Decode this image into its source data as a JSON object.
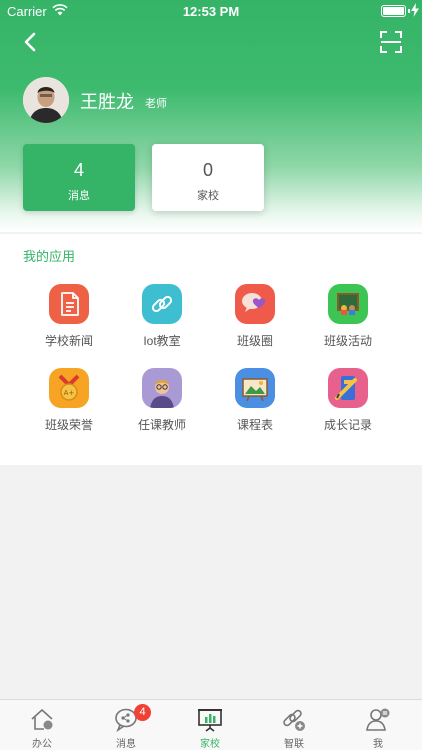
{
  "status_bar": {
    "carrier": "Carrier",
    "time": "12:53 PM"
  },
  "nav": {
    "back_icon": "chevron-left-icon",
    "scan_icon": "scan-icon"
  },
  "profile": {
    "name": "王胜龙",
    "role": "老师"
  },
  "stats": [
    {
      "count": "4",
      "label": "消息"
    },
    {
      "count": "0",
      "label": "家校"
    }
  ],
  "apps": {
    "title": "我的应用",
    "items": [
      {
        "label": "学校新闻",
        "icon": "document-icon"
      },
      {
        "label": "Iot教室",
        "icon": "link-icon"
      },
      {
        "label": "班级圈",
        "icon": "chat-heart-icon"
      },
      {
        "label": "班级活动",
        "icon": "blackboard-icon"
      },
      {
        "label": "班级荣誉",
        "icon": "medal-icon"
      },
      {
        "label": "任课教师",
        "icon": "teacher-icon"
      },
      {
        "label": "课程表",
        "icon": "picture-board-icon"
      },
      {
        "label": "成长记录",
        "icon": "growth-record-icon"
      }
    ]
  },
  "tabbar": {
    "items": [
      {
        "label": "办公",
        "icon": "office-icon"
      },
      {
        "label": "消息",
        "icon": "message-icon",
        "badge": "4"
      },
      {
        "label": "家校",
        "icon": "home-school-icon",
        "active": true
      },
      {
        "label": "智联",
        "icon": "smart-link-icon"
      },
      {
        "label": "我",
        "icon": "profile-icon"
      }
    ]
  },
  "colors": {
    "brand_green": "#35b367",
    "badge_red": "#f04136"
  }
}
